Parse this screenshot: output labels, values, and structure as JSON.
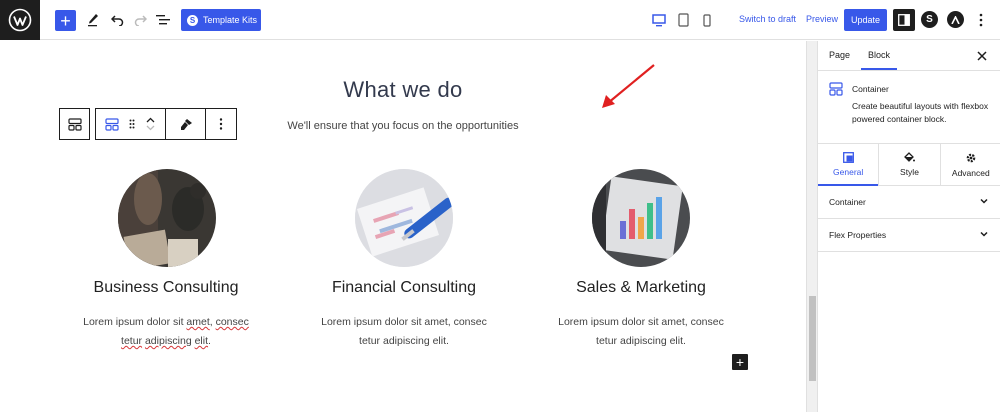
{
  "toolbar": {
    "template_kits_label": "Template Kits",
    "switch_to_draft_label": "Switch to draft",
    "preview_label": "Preview",
    "update_label": "Update"
  },
  "content": {
    "heading": "What we do",
    "subheading": "We'll ensure that you focus on the opportunities",
    "services": [
      {
        "title": "Business Consulting",
        "desc_line1_a": "Lorem ipsum dolor sit ",
        "desc_line1_b": "amet",
        "desc_line1_c": ", ",
        "desc_line1_d": "consec",
        "desc_line2_a": "tetur",
        "desc_line2_b": " ",
        "desc_line2_c": "adipiscing",
        "desc_line2_d": " ",
        "desc_line2_e": "elit",
        "desc_line2_f": "."
      },
      {
        "title": "Financial Consulting",
        "desc_line1": "Lorem ipsum dolor sit amet, consec",
        "desc_line2": "tetur adipiscing elit."
      },
      {
        "title": "Sales & Marketing",
        "desc_line1": "Lorem ipsum dolor sit amet, consec",
        "desc_line2": "tetur adipiscing elit."
      }
    ]
  },
  "sidebar": {
    "tabs": [
      "Page",
      "Block"
    ],
    "block_title": "Container",
    "block_desc": "Create beautiful layouts with flexbox powered container block.",
    "inner_tabs": [
      "General",
      "Style",
      "Advanced"
    ],
    "panels": [
      "Container",
      "Flex Properties"
    ]
  },
  "colors": {
    "accent": "#3858e9",
    "dark": "#1e1e1e",
    "annotation_arrow": "#e02020"
  }
}
